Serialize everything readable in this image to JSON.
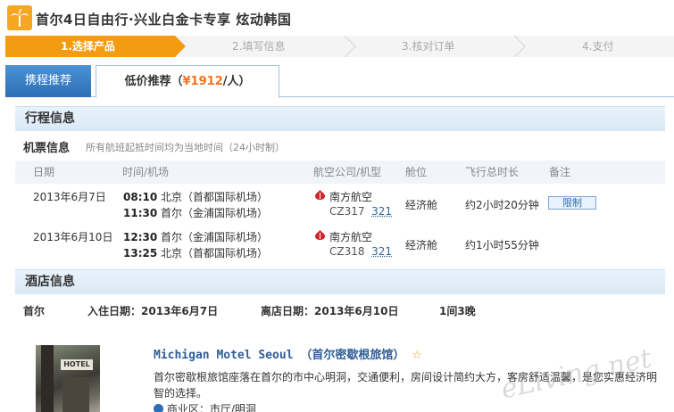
{
  "header": {
    "title": "首尔4日自由行·兴业白金卡专享 炫动韩国"
  },
  "steps": [
    {
      "label": "1.选择产品",
      "active": true
    },
    {
      "label": "2.填写信息",
      "active": false
    },
    {
      "label": "3.核对订单",
      "active": false
    },
    {
      "label": "4.支付",
      "active": false
    }
  ],
  "tabs": {
    "tab1": "携程推荐",
    "tab2_prefix": "低价推荐（",
    "tab2_price": "¥1912",
    "tab2_suffix": "/人）"
  },
  "itinerary": {
    "title": "行程信息",
    "flight_title": "机票信息",
    "flight_note": "所有航班起抵时间均为当地时间（24小时制）",
    "columns": [
      "日期",
      "时间/机场",
      "航空公司/机型",
      "舱位",
      "飞行总时长",
      "备注"
    ],
    "flights": [
      {
        "date": "2013年6月7日",
        "dep_time": "08:10",
        "dep_airport": "北京（首都国际机场）",
        "arr_time": "11:30",
        "arr_airport": "首尔（金浦国际机场）",
        "airline": "南方航空",
        "flight_no": "CZ317",
        "plane": "321",
        "cabin": "经济舱",
        "duration": "约2小时20分钟",
        "remark": "限制"
      },
      {
        "date": "2013年6月10日",
        "dep_time": "12:30",
        "dep_airport": "首尔（金浦国际机场）",
        "arr_time": "13:25",
        "arr_airport": "北京（首都国际机场）",
        "airline": "南方航空",
        "flight_no": "CZ318",
        "plane": "321",
        "cabin": "经济舱",
        "duration": "约1小时55分钟",
        "remark": ""
      }
    ]
  },
  "hotel": {
    "title": "酒店信息",
    "city": "首尔",
    "checkin": "入住日期：2013年6月7日",
    "checkout": "离店日期：2013年6月10日",
    "rooms": "1间3晚",
    "name": "Michigan Motel Seoul （首尔密歇根旅馆）",
    "star": "☆",
    "description": "首尔密歇根旅馆座落在首尔的市中心明洞，交通便利，房间设计简约大方，客房舒适温馨，是您实惠经济明智的选择。",
    "district": "商业区：市厅/明洞",
    "image_text": "HOTEL"
  },
  "watermark": "eLiving.net",
  "colors": {
    "accent": "#f39c12",
    "tab_blue": "#2e6fb6",
    "price": "#f37321"
  }
}
